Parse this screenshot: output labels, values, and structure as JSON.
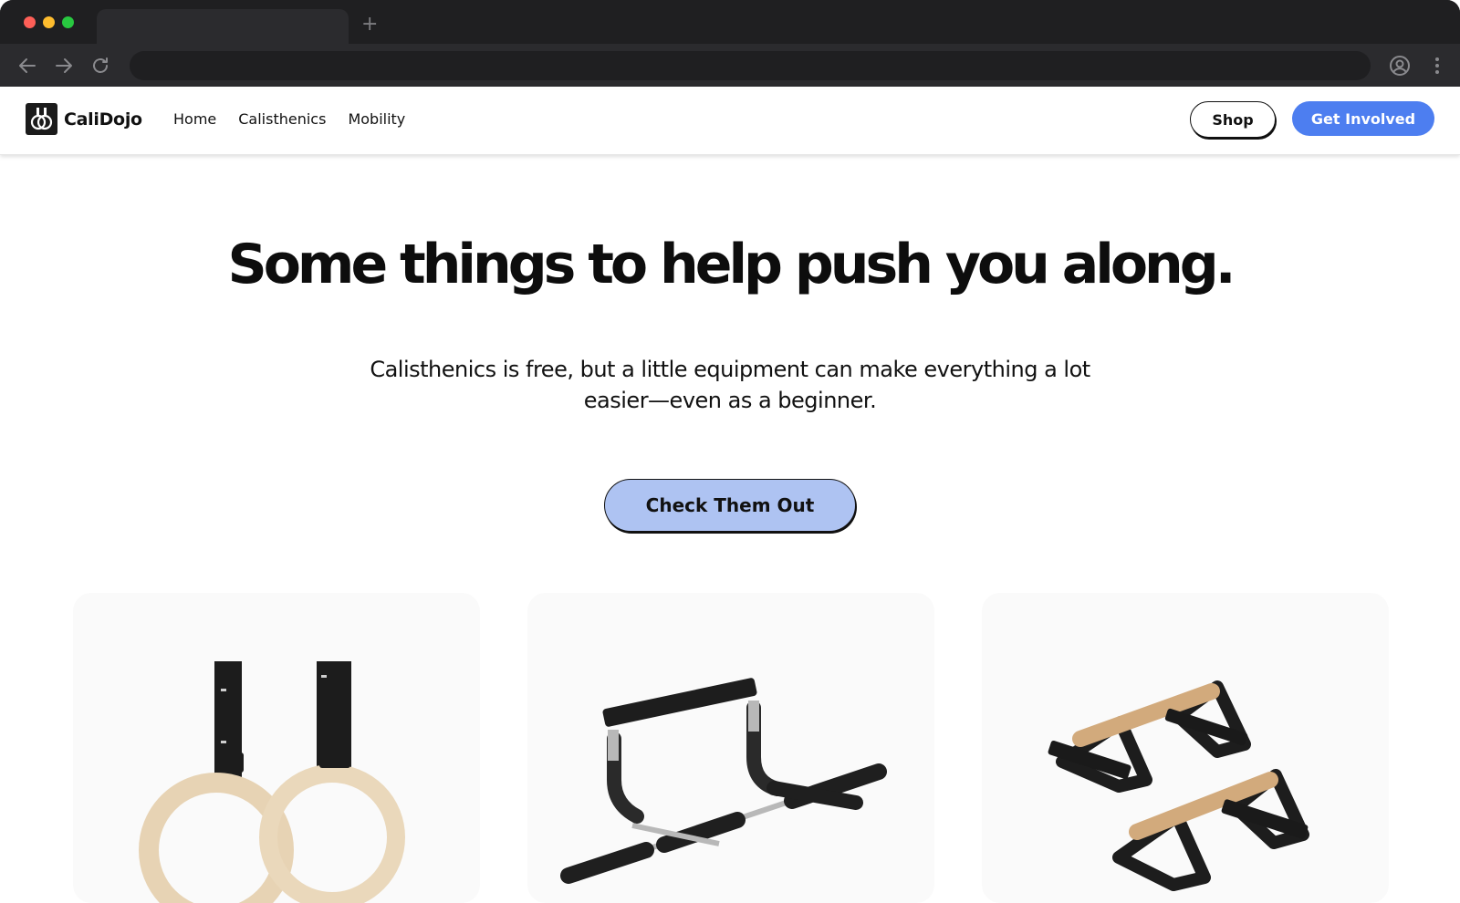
{
  "site": {
    "logo_text": "CaliDojo",
    "nav": [
      "Home",
      "Calisthenics",
      "Mobility"
    ],
    "shop_label": "Shop",
    "involved_label": "Get Involved"
  },
  "hero": {
    "title_pre": "Some things to help ",
    "title_highlight": "push you",
    "title_post": " along.",
    "subtitle": "Calisthenics is free, but a little equipment can make everything a lot easier—even as a beginner.",
    "cta_label": "Check Them Out"
  },
  "cards": [
    {
      "icon": "gymnastic-rings-image"
    },
    {
      "icon": "pull-up-bar-image"
    },
    {
      "icon": "parallettes-image"
    }
  ],
  "colors": {
    "accent": "#4d7ef0",
    "highlight": "#b3c6f2",
    "cta_bg": "#aec3f2"
  }
}
